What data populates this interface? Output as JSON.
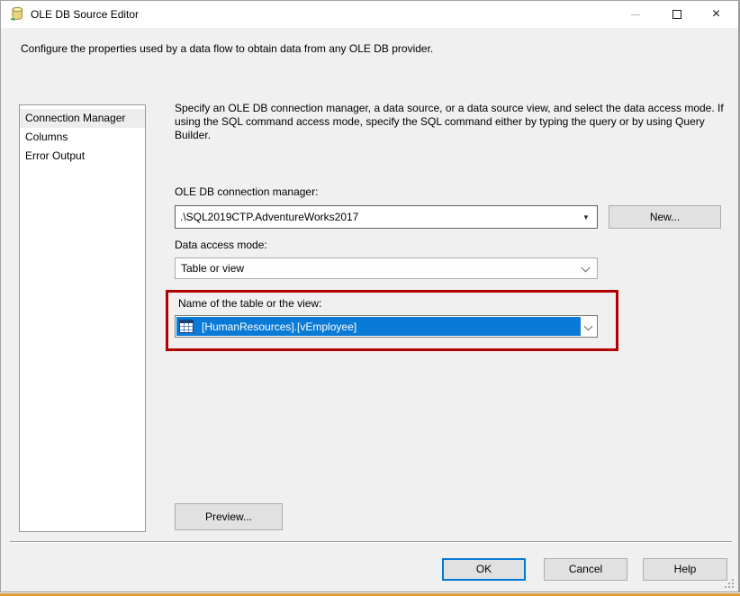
{
  "window": {
    "title": "OLE DB Source Editor",
    "description": "Configure the properties used by a data flow to obtain data from any OLE DB provider."
  },
  "sidebar": {
    "items": [
      {
        "label": "Connection Manager",
        "selected": true
      },
      {
        "label": "Columns",
        "selected": false
      },
      {
        "label": "Error Output",
        "selected": false
      }
    ]
  },
  "main": {
    "instructions": "Specify an OLE DB connection manager, a data source, or a data source view, and select the data access mode. If using the SQL command access mode, specify the SQL command either by typing the query or by using Query Builder.",
    "connection_manager": {
      "label": "OLE DB connection manager:",
      "value": ".\\SQL2019CTP.AdventureWorks2017",
      "new_button": "New..."
    },
    "data_access_mode": {
      "label": "Data access mode:",
      "value": "Table or view"
    },
    "table_name": {
      "label": "Name of the table or the view:",
      "value": "[HumanResources].[vEmployee]"
    },
    "preview_button": "Preview..."
  },
  "footer": {
    "ok": "OK",
    "cancel": "Cancel",
    "help": "Help"
  },
  "icons": {
    "close_glyph": "×",
    "dropdown_arrow_glyph": "▼"
  },
  "colors": {
    "selection_blue": "#0a7ad7",
    "annotation_red": "#b20000",
    "focus_blue": "#0078d7",
    "accent_orange": "#df9d40"
  }
}
